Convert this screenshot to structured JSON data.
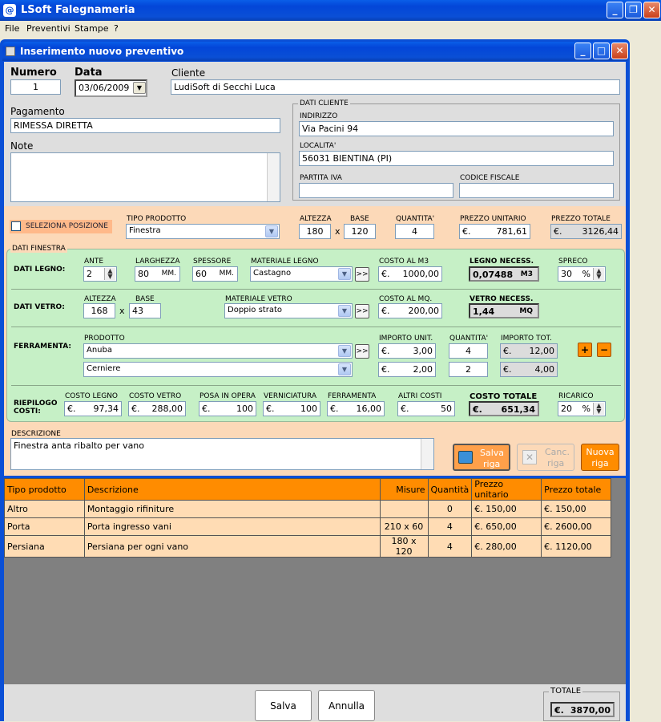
{
  "app": {
    "title": "LSoft Falegnameria",
    "menu": [
      "File",
      "Preventivi",
      "Stampe",
      "?"
    ]
  },
  "dialog": {
    "title": "Inserimento nuovo preventivo"
  },
  "header": {
    "numero_label": "Numero",
    "numero": "1",
    "data_label": "Data",
    "data": "03/06/2009",
    "cliente_label": "Cliente",
    "cliente": "LudiSoft di Secchi Luca",
    "pagamento_label": "Pagamento",
    "pagamento": "RIMESSA DIRETTA",
    "note_label": "Note",
    "note": ""
  },
  "dati_cliente": {
    "group": "DATI CLIENTE",
    "indirizzo_label": "INDIRIZZO",
    "indirizzo": "Via Pacini 94",
    "localita_label": "LOCALITA'",
    "localita": "56031 BIENTINA (PI)",
    "piva_label": "PARTITA IVA",
    "piva": "",
    "cf_label": "CODICE FISCALE",
    "cf": ""
  },
  "riga": {
    "seleziona": "SELEZIONA POSIZIONE",
    "tipo_label": "TIPO PRODOTTO",
    "tipo": "Finestra",
    "altezza_label": "ALTEZZA",
    "altezza": "180",
    "base_label": "BASE",
    "base": "120",
    "x": "x",
    "quantita_label": "QUANTITA'",
    "quantita": "4",
    "prezzo_unit_label": "PREZZO UNITARIO",
    "prezzo_unit": "781,61",
    "prezzo_tot_label": "PREZZO TOTALE",
    "prezzo_tot": "3126,44",
    "euro": "€."
  },
  "finestra": {
    "group": "DATI FINESTRA",
    "legno": {
      "label": "DATI LEGNO:",
      "ante_label": "ANTE",
      "ante": "2",
      "larghezza_label": "LARGHEZZA",
      "larghezza": "80",
      "mm": "MM.",
      "spessore_label": "SPESSORE",
      "spessore": "60",
      "materiale_label": "MATERIALE LEGNO",
      "materiale": "Castagno",
      "costo_label": "COSTO AL M3",
      "costo": "1000,00",
      "necess_label": "LEGNO NECESS.",
      "necess": "0,07488",
      "necess_unit": "M3",
      "spreco_label": "SPRECO",
      "spreco": "30",
      "perc": "%"
    },
    "vetro": {
      "label": "DATI VETRO:",
      "altezza_label": "ALTEZZA",
      "altezza": "168",
      "base_label": "BASE",
      "base": "43",
      "materiale_label": "MATERIALE VETRO",
      "materiale": "Doppio strato",
      "costo_label": "COSTO AL MQ.",
      "costo": "200,00",
      "necess_label": "VETRO NECESS.",
      "necess": "1,44",
      "necess_unit": "MQ"
    },
    "ferramenta": {
      "label": "FERRAMENTA:",
      "prodotto_label": "PRODOTTO",
      "importo_label": "IMPORTO UNIT.",
      "quantita_label": "QUANTITA'",
      "tot_label": "IMPORTO TOT.",
      "rows": [
        {
          "prodotto": "Anuba",
          "importo": "3,00",
          "quantita": "4",
          "tot": "12,00"
        },
        {
          "prodotto": "Cerniere",
          "importo": "2,00",
          "quantita": "2",
          "tot": "4,00"
        }
      ]
    },
    "riepilogo": {
      "label1": "RIEPILOGO",
      "label2": "COSTI:",
      "legno_label": "COSTO LEGNO",
      "legno": "97,34",
      "vetro_label": "COSTO VETRO",
      "vetro": "288,00",
      "posa_label": "POSA IN OPERA",
      "posa": "100",
      "vern_label": "VERNICIATURA",
      "vern": "100",
      "ferr_label": "FERRAMENTA",
      "ferr": "16,00",
      "altri_label": "ALTRI COSTI",
      "altri": "50",
      "totale_label": "COSTO TOTALE",
      "totale": "651,34",
      "ricarico_label": "RICARICO",
      "ricarico": "20"
    }
  },
  "descrizione": {
    "label": "DESCRIZIONE",
    "value": "Finestra anta ribalto per vano"
  },
  "buttons": {
    "salva_riga": [
      "Salva",
      "riga"
    ],
    "canc_riga": [
      "Canc.",
      "riga"
    ],
    "nuova_riga": [
      "Nuova",
      "riga"
    ],
    "salva": "Salva",
    "annulla": "Annulla"
  },
  "table": {
    "headers": [
      "Tipo prodotto",
      "Descrizione",
      "Misure",
      "Quantità",
      "Prezzo unitario",
      "Prezzo totale"
    ],
    "rows": [
      [
        "Altro",
        "Montaggio rifiniture",
        "",
        "0",
        "€. 150,00",
        "€. 150,00"
      ],
      [
        "Porta",
        "Porta ingresso vani",
        "210 x 60",
        "4",
        "€. 650,00",
        "€. 2600,00"
      ],
      [
        "Persiana",
        "Persiana per ogni vano",
        "180 x 120",
        "4",
        "€. 280,00",
        "€. 1120,00"
      ]
    ]
  },
  "totale": {
    "label": "TOTALE",
    "value": "3870,00"
  },
  "colors": {
    "titlebar": "#0a5ee8",
    "form_bg": "#dedede",
    "peach": "#fcd9b8",
    "green": "#c6f0c6",
    "orange": "#ff8c00",
    "row": "#ffdcb4",
    "grid_bg": "#808080"
  }
}
